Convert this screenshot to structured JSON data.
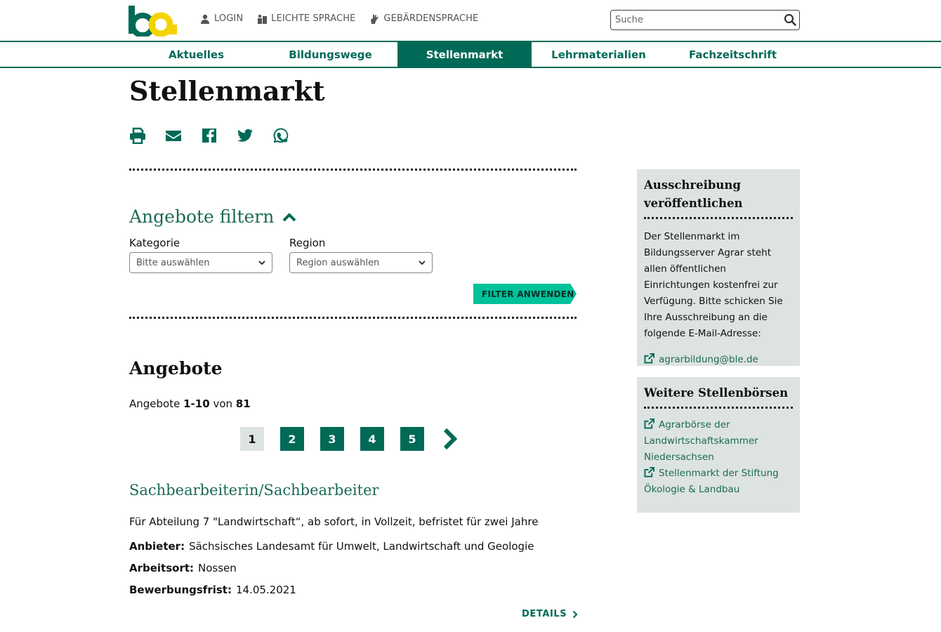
{
  "header": {
    "meta_links": [
      {
        "label": "LOGIN",
        "icon": "user-icon"
      },
      {
        "label": "LEICHTE SPRACHE",
        "icon": "easy-language-icon"
      },
      {
        "label": "GEBÄRDENSPRACHE",
        "icon": "sign-language-icon"
      }
    ],
    "search_placeholder": "Suche"
  },
  "nav": {
    "items": [
      "Aktuelles",
      "Bildungswege",
      "Stellenmarkt",
      "Lehrmaterialien",
      "Fachzeitschrift"
    ],
    "active": "Stellenmarkt"
  },
  "page": {
    "title": "Stellenmarkt",
    "share_icons": [
      "print-icon",
      "mail-icon",
      "facebook-icon",
      "twitter-icon",
      "whatsapp-icon"
    ]
  },
  "filter": {
    "title": "Angebote filtern",
    "kategorie_label": "Kategorie",
    "kategorie_value": "Bitte auswählen",
    "region_label": "Region",
    "region_value": "Region auswählen",
    "apply_label": "FILTER ANWENDEN"
  },
  "results": {
    "heading": "Angebote",
    "count_prefix": "Angebote",
    "count_range": "1-10",
    "count_mid": "von",
    "count_total": "81",
    "pages": [
      "1",
      "2",
      "3",
      "4",
      "5"
    ],
    "current_page": "1"
  },
  "job": {
    "title": "Sachbearbeiterin/Sachbearbeiter",
    "description": "Für Abteilung 7 \"Landwirtschaft“, ab sofort, in Vollzeit, befristet für zwei Jahre",
    "anbieter_label": "Anbieter:",
    "anbieter_value": "Sächsisches Landesamt für Umwelt, Landwirtschaft und Geologie",
    "arbeitsort_label": "Arbeitsort:",
    "arbeitsort_value": "Nossen",
    "frist_label": "Bewerbungsfrist:",
    "frist_value": "14.05.2021",
    "details_label": "DETAILS"
  },
  "sidebar": {
    "box1_title": "Ausschreibung veröffentlichen",
    "box1_text": "Der Stellenmarkt im Bildungsserver Agrar steht allen öffentlichen Einrichtungen kostenfrei zur Verfügung. Bitte schicken Sie Ihre Ausschreibung an die folgende E-Mail-Adresse:",
    "box1_link": "agrarbildung@ble.de",
    "box2_title": "Weitere Stellenbörsen",
    "box2_links": [
      "Agrarbörse der Landwirtschaftskammer Niedersachsen",
      "Stellenmarkt der Stiftung Ökologie & Landbau"
    ]
  },
  "colors": {
    "brand_green": "#006a57",
    "accent_mint": "#00c29a",
    "sidebar_bg": "#dde3e0",
    "logo_yellow": "#f5d300"
  }
}
